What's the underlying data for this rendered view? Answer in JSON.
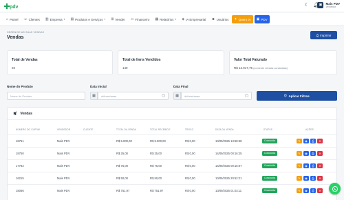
{
  "brand": {
    "logo_text": "pdv",
    "primary": "#1e4fa3",
    "accent_orange": "#f59e0b",
    "accent_blue": "#2563eb",
    "success": "#22a55a"
  },
  "topbar": {
    "user_name": "Mais PDV",
    "user_role": "Vendedor"
  },
  "nav": [
    {
      "label": "Painel",
      "icon": "home-icon"
    },
    {
      "label": "Clientes",
      "icon": "users-icon"
    },
    {
      "label": "Empresa",
      "icon": "building-icon",
      "dropdown": true
    },
    {
      "label": "Produtos e Serviços",
      "icon": "box-icon",
      "dropdown": true
    },
    {
      "label": "Vender",
      "icon": "cart-icon"
    },
    {
      "label": "Financeiro",
      "icon": "wallet-icon"
    },
    {
      "label": "Relatórios",
      "icon": "chart-icon",
      "dropdown": true
    },
    {
      "label": "IA Empresarial",
      "icon": "robot-icon"
    },
    {
      "label": "Usuários",
      "icon": "user-group-icon"
    },
    {
      "label": "Quero IA",
      "icon": "sparkle-icon"
    },
    {
      "label": "PDV",
      "icon": "cash-register-icon"
    }
  ],
  "page": {
    "breadcrumb": "GERENCIE AS SUAS VENDAS",
    "title": "Vendas",
    "print_label": "Imprimir"
  },
  "stats": [
    {
      "label": "Total de Vendas",
      "value": "20"
    },
    {
      "label": "Total de Itens Vendidos",
      "value": "149"
    },
    {
      "label": "Valor Total Faturado",
      "value": "R$ 12.917,75",
      "note": "(somente vendas concluídas)"
    }
  ],
  "filters": {
    "product_label": "Nome do Produto",
    "product_placeholder": "Nome do Produto",
    "start_label": "Data Inicial",
    "start_placeholder": "dd/mm/aaaa",
    "end_label": "Data Final",
    "end_placeholder": "dd/mm/aaaa",
    "apply_label": "Aplicar Filtros"
  },
  "table": {
    "title": "Vendas",
    "columns": [
      "NÚMERO DO CUPOM",
      "VENDEDOR",
      "CLIENTE",
      "TOTAL DA VENDA",
      "TOTAL RECEBIDO",
      "TROCO",
      "DATA DA VENDA",
      "STATUS",
      "AÇÕES"
    ],
    "rows": [
      {
        "cupom": "18751",
        "vendedor": "Mais PDV",
        "cliente": "",
        "total": "R$ 5.000,00",
        "recebido": "R$ 5.000,00",
        "troco": "R$ 0,00",
        "data": "10/09/2025 13:58:38",
        "status": "Concluída"
      },
      {
        "cupom": "18750",
        "vendedor": "Mais PDV",
        "cliente": "",
        "total": "R$ 25,00",
        "recebido": "R$ 25,00",
        "troco": "R$ 0,00",
        "data": "14/09/2025 00:16:25",
        "status": "Concluída"
      },
      {
        "cupom": "17782",
        "vendedor": "Mais PDV",
        "cliente": "",
        "total": "R$ 75,00",
        "recebido": "R$ 75,00",
        "troco": "R$ 0,00",
        "data": "14/09/2025 00:16:07",
        "status": "Concluída"
      },
      {
        "cupom": "16215",
        "vendedor": "Mais PDV",
        "cliente": "",
        "total": "R$ 50,00",
        "recebido": "R$ 50,00",
        "troco": "R$ 0,00",
        "data": "10/09/2025 20:52:21",
        "status": "Concluída"
      },
      {
        "cupom": "18066",
        "vendedor": "Mais PDV",
        "cliente": "",
        "total": "R$ 751,97",
        "recebido": "R$ 751,97",
        "troco": "R$ 0,00",
        "data": "10/09/2025 01:03:11",
        "status": "Concluída"
      }
    ]
  }
}
